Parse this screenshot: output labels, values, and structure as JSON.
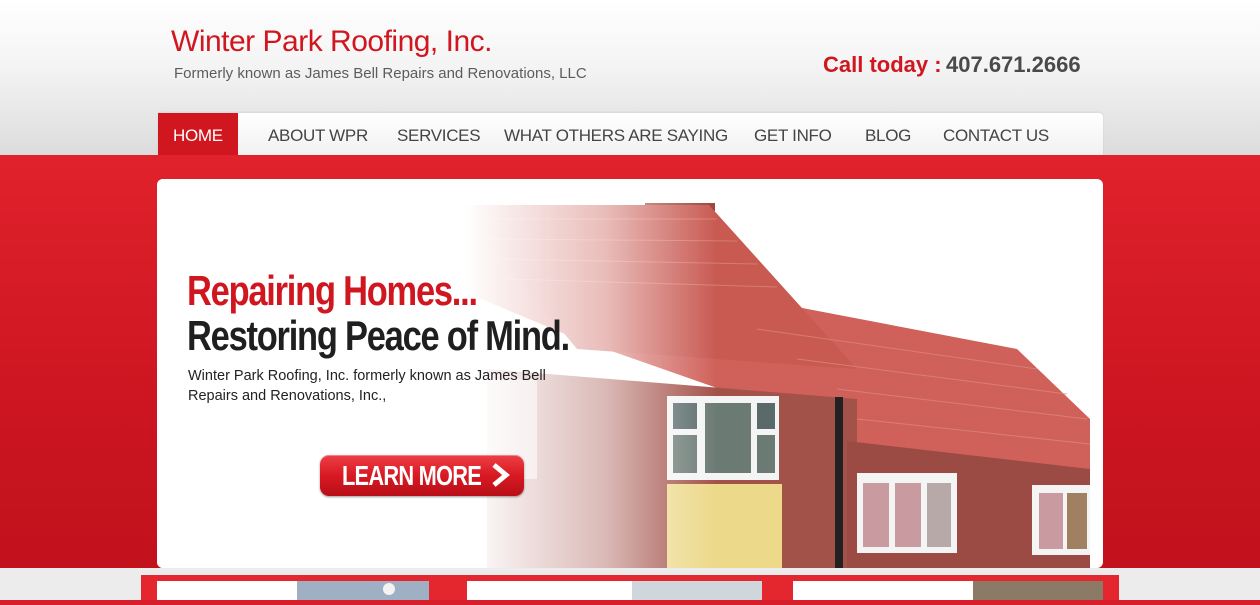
{
  "header": {
    "site_title": "Winter Park Roofing, Inc.",
    "site_subtitle": "Formerly known as James Bell Repairs and Renovations, LLC",
    "call_label": "Call today :",
    "phone": "407.671.2666"
  },
  "nav": {
    "items": [
      {
        "label": "HOME",
        "active": true
      },
      {
        "label": "ABOUT WPR"
      },
      {
        "label": "SERVICES"
      },
      {
        "label": "WHAT OTHERS ARE SAYING"
      },
      {
        "label": "GET INFO"
      },
      {
        "label": "BLOG"
      },
      {
        "label": "CONTACT US"
      }
    ]
  },
  "hero": {
    "headline_1": "Repairing Homes...",
    "headline_2": "Restoring Peace of Mind.",
    "description": "Winter Park Roofing, Inc. formerly known as James Bell Repairs and Renovations, Inc.,",
    "button_label": "LEARN MORE",
    "image_alt": "house-with-red-tile-roof"
  },
  "colors": {
    "brand_red": "#d0161f",
    "text_dark": "#1f1f1f"
  }
}
